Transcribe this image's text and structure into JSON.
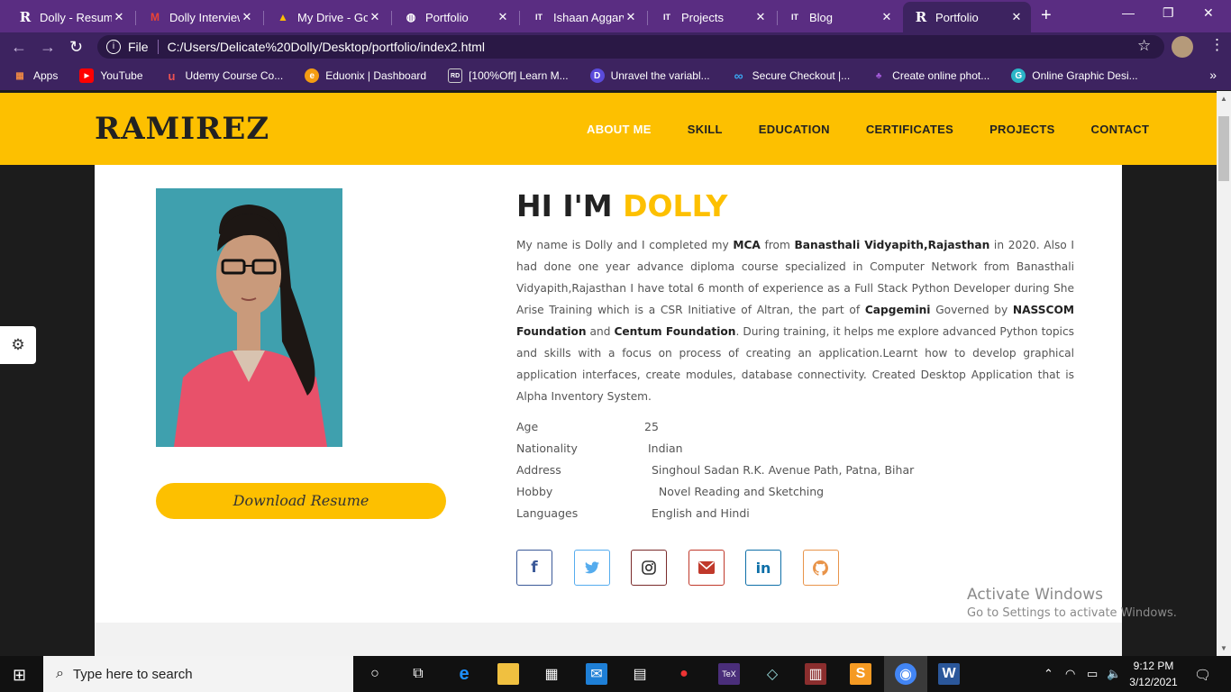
{
  "browser": {
    "tabs": [
      {
        "title": "Dolly - Resume",
        "favicon": "R",
        "active": false
      },
      {
        "title": "Dolly Interview",
        "favicon": "M",
        "active": false
      },
      {
        "title": "My Drive - Go",
        "favicon": "drive",
        "active": false
      },
      {
        "title": "Portfolio",
        "favicon": "globe",
        "active": false
      },
      {
        "title": "Ishaan Aggarw",
        "favicon": "IT",
        "active": false
      },
      {
        "title": "Projects",
        "favicon": "IT",
        "active": false
      },
      {
        "title": "Blog",
        "favicon": "IT",
        "active": false
      },
      {
        "title": "Portfolio",
        "favicon": "R",
        "active": true
      }
    ],
    "address": {
      "scheme_label": "File",
      "url": "C:/Users/Delicate%20Dolly/Desktop/portfolio/index2.html"
    },
    "bookmarks": [
      {
        "label": "Apps",
        "icon": "apps-grid"
      },
      {
        "label": "YouTube",
        "icon": "youtube"
      },
      {
        "label": "Udemy Course Co...",
        "icon": "udemy"
      },
      {
        "label": "Eduonix | Dashboard",
        "icon": "eduonix"
      },
      {
        "label": "[100%Off] Learn M...",
        "icon": "rd"
      },
      {
        "label": "Unravel the variabl...",
        "icon": "unravel"
      },
      {
        "label": "Secure Checkout |...",
        "icon": "infinity"
      },
      {
        "label": "Create online phot...",
        "icon": "photo"
      },
      {
        "label": "Online Graphic Desi...",
        "icon": "graphic"
      }
    ],
    "more": "»"
  },
  "site": {
    "logo": "RAMIREZ",
    "nav": [
      "ABOUT ME",
      "SKILL",
      "EDUCATION",
      "CERTIFICATES",
      "PROJECTS",
      "CONTACT"
    ],
    "active_nav": "ABOUT ME",
    "download_label": "Download Resume",
    "greeting_prefix": "HI I'M",
    "greeting_name": "DOLLY",
    "bio": {
      "p1": "My name is Dolly and I completed my ",
      "b1": "MCA",
      "p2": " from ",
      "b2": "Banasthali Vidyapith,Rajasthan",
      "p3": " in 2020. Also I had done one year advance diploma course specialized in Computer Network from Banasthali Vidyapith,Rajasthan I have total 6 month of experience as a Full Stack Python Developer during She Arise Training which is a CSR Initiative of Altran, the part of ",
      "b3": "Capgemini",
      "p4": " Governed by ",
      "b4": "NASSCOM Foundation",
      "p5": " and ",
      "b5": "Centum Foundation",
      "p6": ". During training, it helps me explore advanced Python topics and skills with a focus on process of creating an application.Learnt how to develop graphical application interfaces, create modules, database connectivity. Created Desktop Application that is Alpha Inventory System."
    },
    "info": [
      {
        "key": "Age",
        "value": "25"
      },
      {
        "key": "Nationality",
        "value": " Indian"
      },
      {
        "key": "Address",
        "value": "  Singhoul Sadan R.K. Avenue Path, Patna, Bihar"
      },
      {
        "key": "Hobby",
        "value": "    Novel Reading and Sketching"
      },
      {
        "key": "Languages",
        "value": "  English and Hindi"
      }
    ],
    "socials": [
      {
        "name": "facebook",
        "glyph": "f",
        "color": "#3b5998"
      },
      {
        "name": "twitter",
        "glyph": "🐦",
        "color": "#55acee"
      },
      {
        "name": "instagram",
        "glyph": "◎",
        "color": "#7a2b2b"
      },
      {
        "name": "email",
        "glyph": "✉",
        "color": "#c0392b"
      },
      {
        "name": "linkedin",
        "glyph": "in",
        "color": "#0e6fa8"
      },
      {
        "name": "github",
        "glyph": "🐙",
        "color": "#e8944a"
      }
    ],
    "accent": "#fdc000"
  },
  "watermark": {
    "line1": "Activate Windows",
    "line2": "Go to Settings to activate Windows."
  },
  "taskbar": {
    "search_placeholder": "Type here to search",
    "time": "9:12 PM",
    "date": "3/12/2021"
  }
}
